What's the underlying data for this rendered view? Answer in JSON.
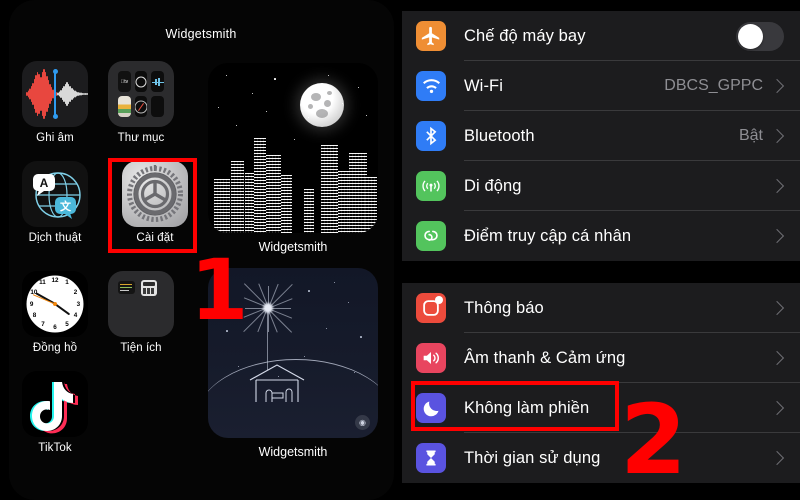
{
  "home": {
    "widget_top_title": "Widgetsmith",
    "apps": [
      {
        "label": "Ghi âm",
        "icon": "voice-memos-icon"
      },
      {
        "label": "Thư mục",
        "icon": "folder-icon"
      },
      {
        "label": "Dịch thuật",
        "icon": "translate-icon"
      },
      {
        "label": "Cài đặt",
        "icon": "settings-gear-icon"
      },
      {
        "label": "Đồng hồ",
        "icon": "clock-icon"
      },
      {
        "label": "Tiện ích",
        "icon": "utilities-folder-icon"
      },
      {
        "label": "TikTok",
        "icon": "tiktok-icon"
      }
    ],
    "widgets": [
      {
        "label": "Widgetsmith",
        "art": "moon-city-skyline"
      },
      {
        "label": "Widgetsmith",
        "art": "nativity-star-scene"
      }
    ]
  },
  "settings": {
    "group1": [
      {
        "title": "Chế độ máy bay",
        "icon": "airplane-icon",
        "color": "#ef8e34",
        "control": "toggle",
        "toggle_on": false
      },
      {
        "title": "Wi-Fi",
        "icon": "wifi-icon",
        "color": "#2f7cf6",
        "control": "value",
        "value": "DBCS_GPPC"
      },
      {
        "title": "Bluetooth",
        "icon": "bluetooth-icon",
        "color": "#2f7cf6",
        "control": "value",
        "value": "Bật"
      },
      {
        "title": "Di động",
        "icon": "cellular-icon",
        "color": "#53c45d",
        "control": "chevron",
        "value": ""
      },
      {
        "title": "Điểm truy cập cá nhân",
        "icon": "hotspot-icon",
        "color": "#53c45d",
        "control": "chevron",
        "value": ""
      }
    ],
    "group2": [
      {
        "title": "Thông báo",
        "icon": "notifications-icon",
        "color": "#ec4b3c",
        "control": "chevron",
        "value": ""
      },
      {
        "title": "Âm thanh & Cảm ứng",
        "icon": "sounds-haptics-icon",
        "color": "#e8455f",
        "control": "chevron",
        "value": ""
      },
      {
        "title": "Không làm phiền",
        "icon": "moon-dnd-icon",
        "color": "#5a53e0",
        "control": "chevron",
        "value": ""
      },
      {
        "title": "Thời gian sử dụng",
        "icon": "screen-time-icon",
        "color": "#5a53e0",
        "control": "chevron",
        "value": ""
      }
    ]
  },
  "annotations": {
    "step1": "1",
    "step2": "2",
    "highlight_color": "#ff0000",
    "highlight_1_target": "Cài đặt",
    "highlight_2_target": "Không làm phiền"
  }
}
